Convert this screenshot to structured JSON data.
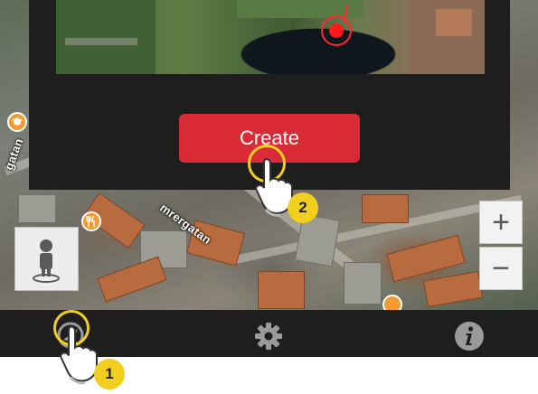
{
  "map": {
    "street_label": "mrergatan",
    "left_label": "gatan",
    "restaurant_icon": "fork-knife-icon",
    "education_icon": "graduation-cap-icon"
  },
  "panel": {
    "create_label": "Create"
  },
  "zoom": {
    "in_label": "+",
    "out_label": "−"
  },
  "toolbar": {
    "items": [
      {
        "icon": "map-compass-icon"
      },
      {
        "icon": "gear-icon"
      },
      {
        "icon": "info-icon"
      }
    ]
  },
  "callouts": {
    "step1": "1",
    "step2": "2"
  },
  "colors": {
    "accent_red": "#d92b35",
    "callout_yellow": "#f2cf1f",
    "bar_dark": "#1e1e1e"
  }
}
